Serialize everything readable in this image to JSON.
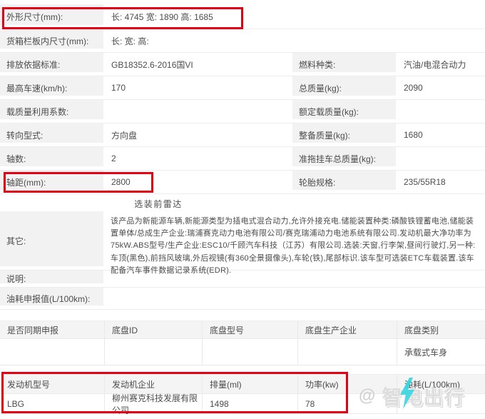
{
  "colors": {
    "highlight_red": "#e60012",
    "label_bg": "#f2f2f2",
    "border": "#e9e9e9",
    "text": "#4c4c4c",
    "watermark_gray": "#dbdbdb",
    "watermark_bolt_cyan": "#35d6e2"
  },
  "spec_rows": [
    {
      "left_label": "外形尺寸(mm):",
      "left_value": "长: 4745 宽: 1890 高: 1685",
      "right_label": "",
      "right_value": ""
    },
    {
      "left_label": "货箱栏板内尺寸(mm):",
      "left_value": "长: 宽: 高:",
      "right_label": "",
      "right_value": ""
    },
    {
      "left_label": "排放依据标准:",
      "left_value": "GB18352.6-2016国VI",
      "right_label": "燃料种类:",
      "right_value": "汽油/电混合动力"
    },
    {
      "left_label": "最高车速(km/h):",
      "left_value": "170",
      "right_label": "总质量(kg):",
      "right_value": "2090"
    },
    {
      "left_label": "载质量利用系数:",
      "left_value": "",
      "right_label": "额定载质量(kg):",
      "right_value": ""
    },
    {
      "left_label": "转向型式:",
      "left_value": "方向盘",
      "right_label": "整备质量(kg):",
      "right_value": "1680"
    },
    {
      "left_label": "轴数:",
      "left_value": "2",
      "right_label": "准拖挂车总质量(kg):",
      "right_value": ""
    },
    {
      "left_label": "轴距(mm):",
      "left_value": "2800",
      "right_label": "轮胎规格:",
      "right_value": "235/55R18"
    }
  ],
  "option_note": "选装前雷达",
  "detail_rows": [
    {
      "label": "其它:",
      "value": "该产品为新能源车辆,新能源类型为插电式混合动力,允许外接充电.储能装置种类:磷酸铁锂蓄电池,储能装置单体/总成生产企业:瑞浦赛克动力电池有限公司/赛克瑞浦动力电池系统有限公司.发动机最大净功率为75kW.ABS型号/生产企业:ESC10/千顾汽车科技（江苏）有限公司.选装:天窗,行李架,昼间行驶灯,另一种:车顶(黑色),前挡风玻璃,外后视镜(有360全景摄像头),车轮(铁),尾部标识.该车型可选装ETC车载装置.该车配备汽车事件数据记录系统(EDR)."
    },
    {
      "label": "说明:",
      "value": ""
    },
    {
      "label": "油耗申报值(L/100km):",
      "value": ""
    }
  ],
  "chassis_table": {
    "headers": [
      "是否同期申报",
      "底盘ID",
      "底盘型号",
      "底盘生产企业",
      "底盘类别"
    ],
    "row": [
      "",
      "",
      "",
      "",
      "承载式车身"
    ]
  },
  "engine_table": {
    "headers": [
      "发动机型号",
      "发动机企业",
      "排量(ml)",
      "功率(kw)",
      "油耗(L/100km)"
    ],
    "row": [
      "LBG",
      "柳州赛克科技发展有限公司",
      "1498",
      "78",
      ""
    ]
  },
  "watermark": {
    "at": "@",
    "text": "智电出行"
  }
}
